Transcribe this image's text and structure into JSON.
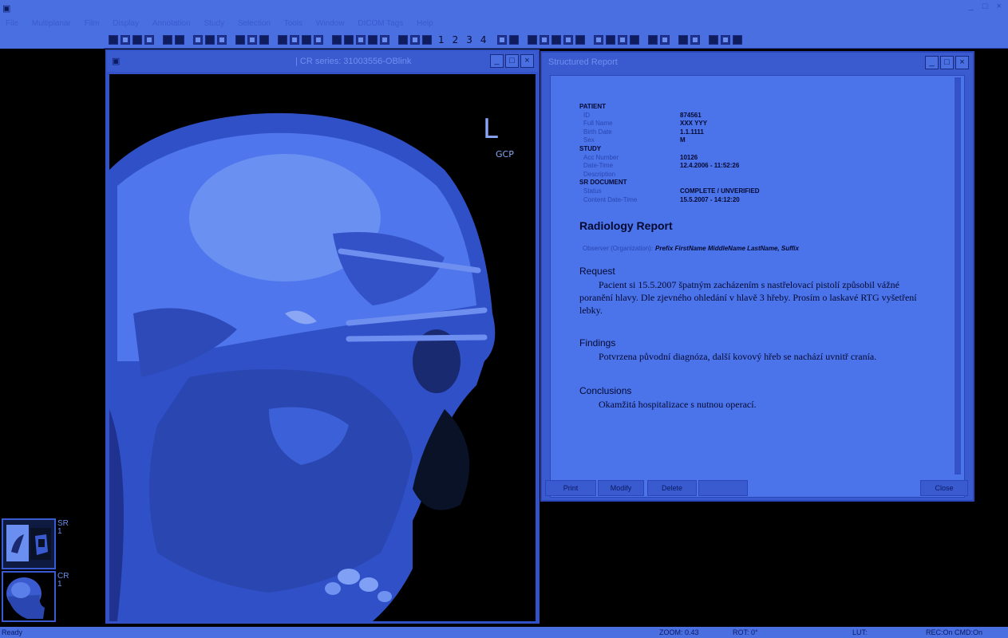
{
  "window": {
    "title": "",
    "app_icon": "app-icon",
    "controls": "_ □ ×"
  },
  "menubar": {
    "items": [
      "File",
      "Multiplanar",
      "Film",
      "Display",
      "Annotation",
      "Study",
      "Selection",
      "Tools",
      "Window",
      "DICOM Tags",
      "Help"
    ]
  },
  "toolbar": {
    "layout_numbers": [
      "1",
      "2",
      "3",
      "4"
    ]
  },
  "sidepanel": {
    "thumbnails": [
      {
        "modality": "SR",
        "index": "1"
      },
      {
        "modality": "CR",
        "index": "1"
      }
    ]
  },
  "viewer": {
    "title": "| CR series: 31003556-OBlink",
    "orientation_marker": "L",
    "marker_initials": "GCP"
  },
  "report": {
    "title": "Structured Report",
    "patient_heading": "PATIENT",
    "patient": [
      {
        "label": "ID",
        "value": "874561"
      },
      {
        "label": "Full Name",
        "value": "XXX YYY"
      },
      {
        "label": "Birth Date",
        "value": "1.1.1111"
      },
      {
        "label": "Sex",
        "value": "M"
      }
    ],
    "study_heading": "STUDY",
    "study": [
      {
        "label": "Acc Number",
        "value": "10126"
      },
      {
        "label": "Date-Time",
        "value": "12.4.2006 - 11:52:26"
      },
      {
        "label": "Description",
        "value": ""
      }
    ],
    "srdoc_heading": "SR DOCUMENT",
    "srdoc": [
      {
        "label": "Status",
        "value": "COMPLETE / UNVERIFIED"
      },
      {
        "label": "Content Date-Time",
        "value": "15.5.2007 - 14:12:20"
      }
    ],
    "report_heading": "Radiology Report",
    "observer_label": "Observer (Organization):",
    "observer_name": "Prefix FirstName MiddleName LastName, Suffix",
    "sections": [
      {
        "heading": "Request",
        "text": "Pacient si 15.5.2007 špatným zacházením s nastřelovací pistolí způsobil vážné poranění hlavy. Dle zjevného ohledání v hlavě 3 hřeby. Prosím o laskavé RTG vyšetření lebky."
      },
      {
        "heading": "Findings",
        "text": "Potvrzena původní diagnóza, další kovový hřeb se nachází uvnitř cranía."
      },
      {
        "heading": "Conclusions",
        "text": "Okamžitá hospitalizace s nutnou operací."
      }
    ],
    "buttons": {
      "print": "Print",
      "modify": "Modify",
      "delete": "Delete",
      "extra": "",
      "close": "Close"
    }
  },
  "status": {
    "ready": "Ready",
    "zoom": "ZOOM: 0.43",
    "rot": "ROT: 0°",
    "lut": "LUT:",
    "rec": "REC:On CMD:On"
  }
}
